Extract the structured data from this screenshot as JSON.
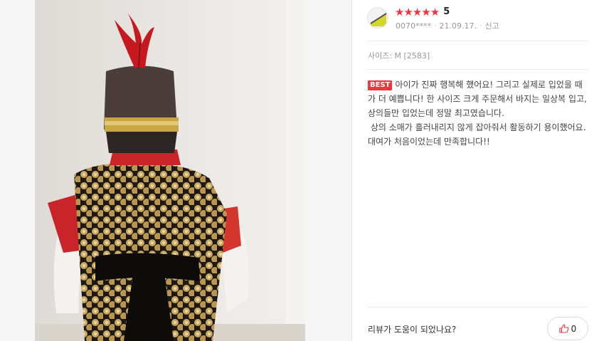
{
  "review": {
    "rating": "5",
    "stars": [
      "★",
      "★",
      "★",
      "★",
      "★"
    ],
    "user": "0070****",
    "date": "21.09.17.",
    "separator": "·",
    "report_label": "신고",
    "size_label": "사이즈: M [2583]",
    "best_badge": "BEST",
    "body_line1": "아이가 진짜 행복해 했어요! 그리고 실제로 입었을 때가 더 예쁩니다! 한 사이즈 크게 주문해서 바지는 일상복 입고, 상의들만 입었는데 정말 최고였습니다.",
    "body_line2": "상의 소매가 흘러내리지 않게 잡아줘서 활동하기 용이했어요. 대여가 처음이었는데 만족합니다!!",
    "helpful_question": "리뷰가 도움이 되었나요?",
    "like_count": "0"
  },
  "colors": {
    "star": "#f2343f",
    "badge": "#f2343f"
  }
}
